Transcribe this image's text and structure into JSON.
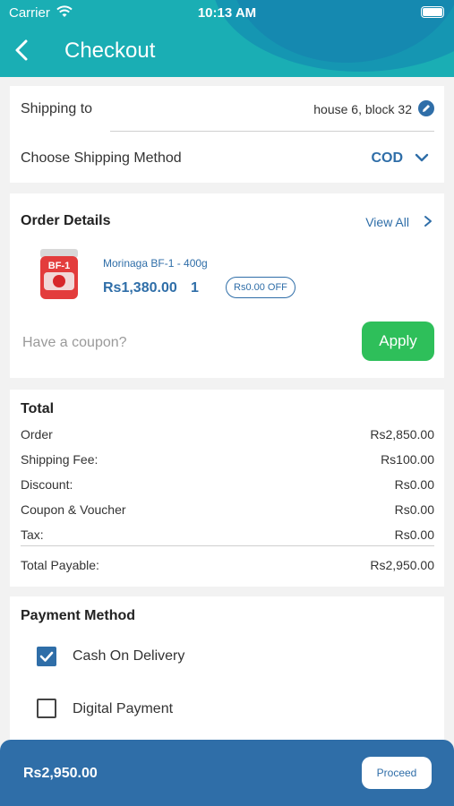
{
  "status_bar": {
    "carrier": "Carrier",
    "time": "10:13 AM"
  },
  "header": {
    "title": "Checkout"
  },
  "shipping": {
    "label": "Shipping to",
    "address": "house 6, block 32",
    "method_label": "Choose Shipping Method",
    "method_value": "COD"
  },
  "order": {
    "title": "Order Details",
    "view_all": "View All",
    "item": {
      "name": "Morinaga BF-1 - 400g",
      "price": "Rs1,380.00",
      "quantity": "1",
      "discount": "Rs0.00 OFF",
      "label_on_product": "BF-1"
    },
    "coupon_placeholder": "Have a coupon?",
    "apply_label": "Apply"
  },
  "totals": {
    "title": "Total",
    "rows": [
      {
        "label": "Order",
        "value": "Rs2,850.00"
      },
      {
        "label": "Shipping Fee:",
        "value": "Rs100.00"
      },
      {
        "label": "Discount:",
        "value": "Rs0.00"
      },
      {
        "label": "Coupon & Voucher",
        "value": "Rs0.00"
      },
      {
        "label": "Tax:",
        "value": "Rs0.00"
      }
    ],
    "payable_label": "Total Payable:",
    "payable_value": "Rs2,950.00"
  },
  "payment": {
    "title": "Payment Method",
    "options": [
      {
        "label": "Cash On Delivery",
        "checked": true
      },
      {
        "label": "Digital Payment",
        "checked": false
      }
    ]
  },
  "footer": {
    "total": "Rs2,950.00",
    "proceed_label": "Proceed"
  },
  "colors": {
    "header": "#1aaeb4",
    "accent": "#2f6ea8",
    "apply": "#2ebf5a"
  },
  "icons": [
    "wifi-icon",
    "battery-icon",
    "back-arrow-icon",
    "edit-pencil-icon",
    "chevron-down-icon",
    "chevron-right-icon",
    "checkbox-checked-icon",
    "checkbox-empty-icon"
  ]
}
